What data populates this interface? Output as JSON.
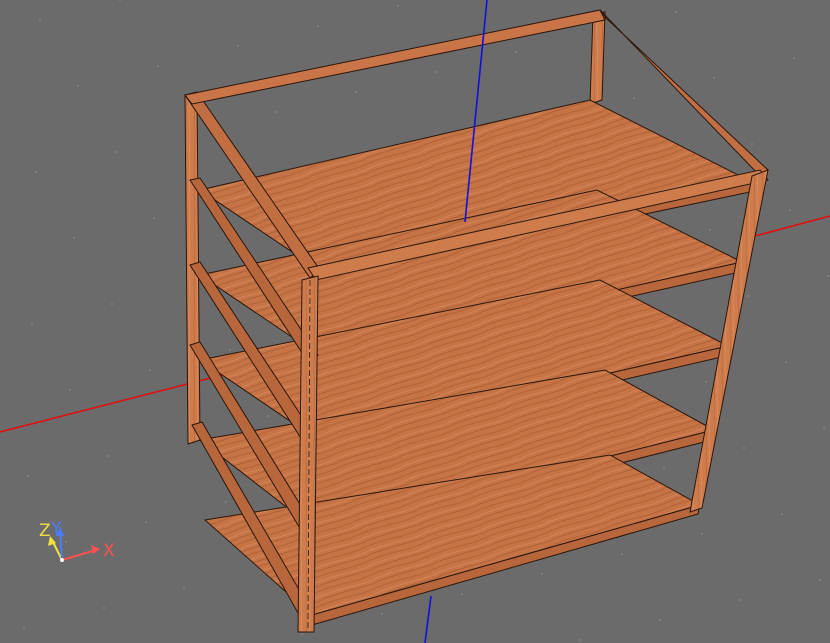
{
  "viewport": {
    "background": "#6b6b6b",
    "grid_dot_color": "#8a8a8a"
  },
  "axes": {
    "x_color": "#e01010",
    "y_color": "#e01010",
    "z_color": "#1010e0"
  },
  "model": {
    "wood_color": "#c9774a",
    "wood_dark": "#9c5530",
    "wood_light": "#dd9a6c",
    "edge_color": "#2a160c",
    "shelf_count": 5
  },
  "triad": {
    "x_label": "X",
    "y_label": "Y",
    "z_label": "Z",
    "x_color": "#ff5050",
    "y_color": "#f0e040",
    "z_color": "#4a7cff"
  }
}
